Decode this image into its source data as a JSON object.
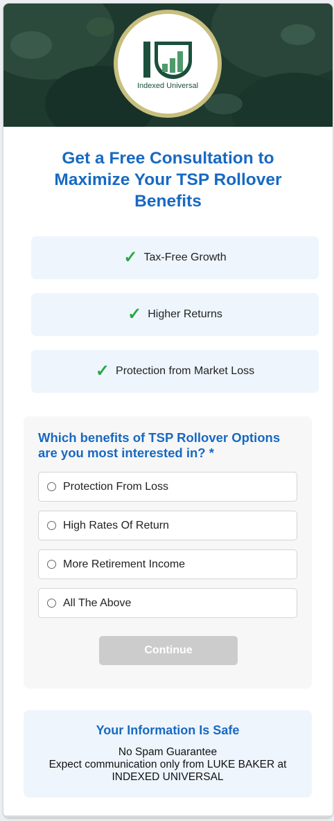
{
  "brand": {
    "logo_text": "Indexed Universal",
    "colors": {
      "brand_green": "#1c4f3c",
      "ring_gold": "#c8bf7e",
      "accent_blue": "#1769c2",
      "check_green": "#28a745"
    }
  },
  "headline": "Get a Free Consultation to Maximize Your TSP Rollover Benefits",
  "benefits": [
    {
      "icon": "check-icon",
      "label": "Tax-Free Growth"
    },
    {
      "icon": "check-icon",
      "label": "Higher Returns"
    },
    {
      "icon": "check-icon",
      "label": "Protection from Market Loss"
    }
  ],
  "form": {
    "question": "Which benefits of TSP Rollover Options are you most interested in? *",
    "options": [
      {
        "label": "Protection From Loss",
        "selected": false
      },
      {
        "label": "High Rates Of Return",
        "selected": false
      },
      {
        "label": "More Retirement Income",
        "selected": false
      },
      {
        "label": "All The Above",
        "selected": false
      }
    ],
    "continue_label": "Continue",
    "continue_disabled": true
  },
  "safety": {
    "title": "Your Information Is Safe",
    "line1": "No Spam Guarantee",
    "line2": "Expect communication only from LUKE BAKER at",
    "line3": "INDEXED UNIVERSAL"
  }
}
